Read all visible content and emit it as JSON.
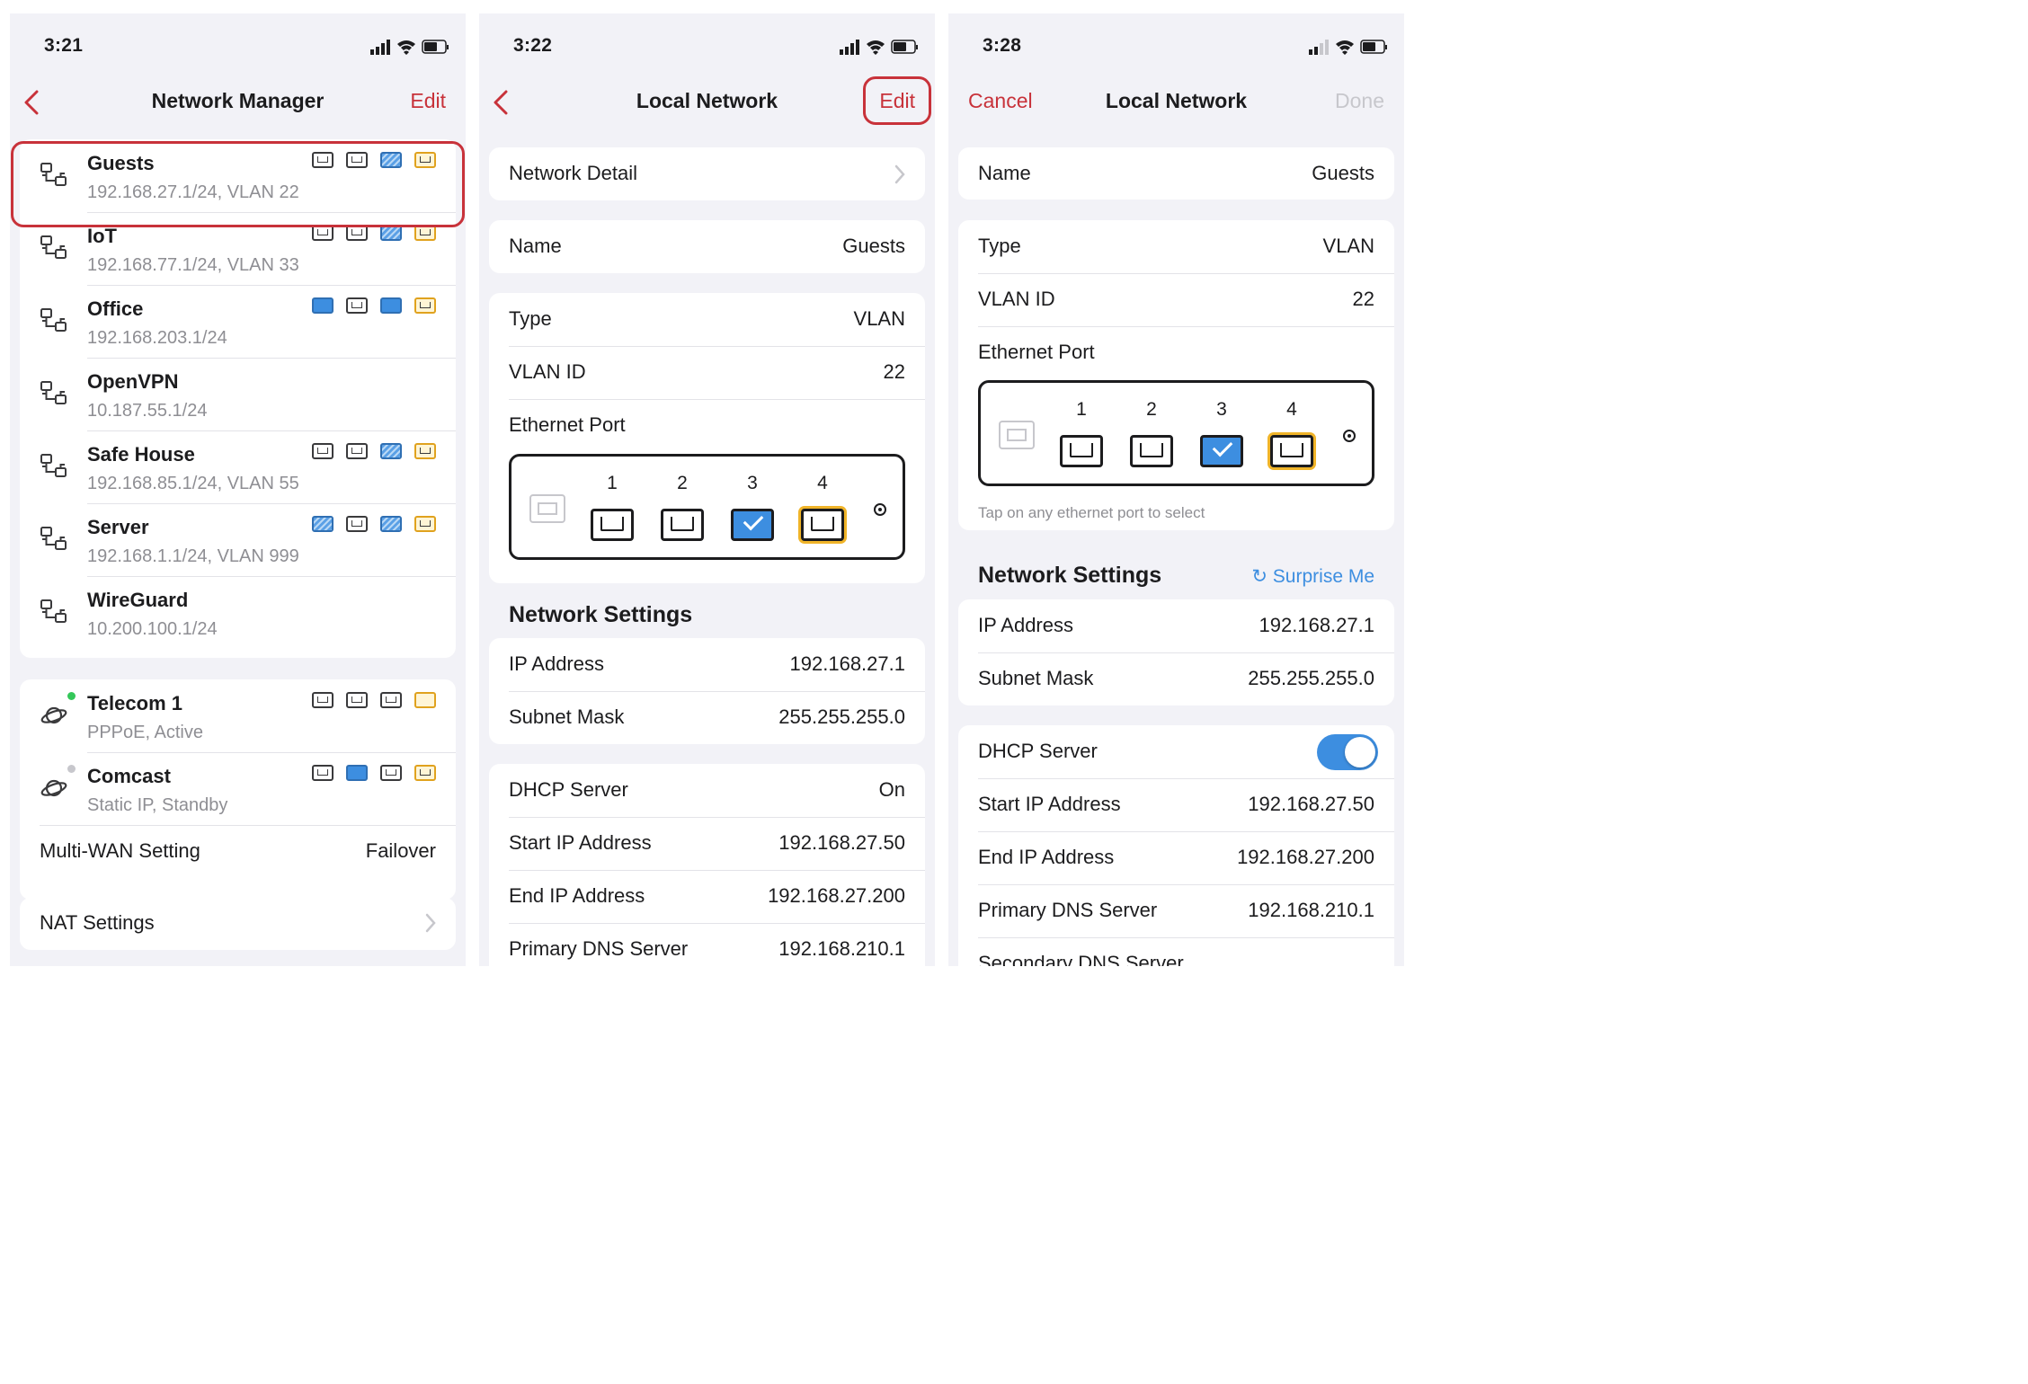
{
  "screens": [
    {
      "status_time": "3:21",
      "nav": {
        "back": "back-chevron",
        "title": "Network Manager",
        "right": "Edit"
      },
      "networks": [
        {
          "name": "Guests",
          "sub": "192.168.27.1/24, VLAN 22",
          "ports": [
            "empty",
            "empty",
            "hatch",
            "gold"
          ]
        },
        {
          "name": "IoT",
          "sub": "192.168.77.1/24, VLAN 33",
          "ports": [
            "empty",
            "empty",
            "hatch",
            "gold"
          ]
        },
        {
          "name": "Office",
          "sub": "192.168.203.1/24",
          "ports": [
            "blue",
            "empty",
            "blue",
            "gold"
          ]
        },
        {
          "name": "OpenVPN",
          "sub": "10.187.55.1/24",
          "ports": []
        },
        {
          "name": "Safe House",
          "sub": "192.168.85.1/24, VLAN 55",
          "ports": [
            "empty",
            "empty",
            "hatch",
            "gold"
          ]
        },
        {
          "name": "Server",
          "sub": "192.168.1.1/24, VLAN 999",
          "ports": [
            "hatch",
            "empty",
            "hatch",
            "gold"
          ]
        },
        {
          "name": "WireGuard",
          "sub": "10.200.100.1/24",
          "ports": []
        }
      ],
      "wans": [
        {
          "name": "Telecom 1",
          "sub": "PPPoE, Active",
          "status_color": "#34c759",
          "ports": [
            "empty",
            "empty",
            "empty",
            "blue-gold"
          ]
        },
        {
          "name": "Comcast",
          "sub": "Static IP, Standby",
          "status_color": "#c7c7cc",
          "ports": [
            "empty",
            "blue",
            "empty",
            "gold"
          ]
        }
      ],
      "multiwan": {
        "label": "Multi-WAN Setting",
        "value": "Failover"
      },
      "nat": {
        "label": "NAT Settings"
      }
    },
    {
      "status_time": "3:22",
      "nav": {
        "title": "Local Network",
        "right": "Edit"
      },
      "detail": "Network Detail",
      "name": {
        "label": "Name",
        "value": "Guests"
      },
      "type": {
        "label": "Type",
        "value": "VLAN"
      },
      "vlan": {
        "label": "VLAN ID",
        "value": "22"
      },
      "eth_label": "Ethernet Port",
      "port_numbers": [
        "1",
        "2",
        "3",
        "4"
      ],
      "section": "Network Settings",
      "ip": {
        "label": "IP Address",
        "value": "192.168.27.1"
      },
      "mask": {
        "label": "Subnet Mask",
        "value": "255.255.255.0"
      },
      "dhcp": {
        "label": "DHCP Server",
        "value": "On"
      },
      "start": {
        "label": "Start IP Address",
        "value": "192.168.27.50"
      },
      "end": {
        "label": "End IP Address",
        "value": "192.168.27.200"
      },
      "dns": {
        "label": "Primary DNS Server",
        "value": "192.168.210.1"
      }
    },
    {
      "status_time": "3:28",
      "nav": {
        "left": "Cancel",
        "title": "Local Network",
        "right": "Done"
      },
      "name": {
        "label": "Name",
        "value": "Guests"
      },
      "type": {
        "label": "Type",
        "value": "VLAN"
      },
      "vlan": {
        "label": "VLAN ID",
        "value": "22"
      },
      "eth_label": "Ethernet Port",
      "port_numbers": [
        "1",
        "2",
        "3",
        "4"
      ],
      "hint": "Tap on any ethernet port to select",
      "section": "Network Settings",
      "surprise": "Surprise Me",
      "ip": {
        "label": "IP Address",
        "value": "192.168.27.1"
      },
      "mask": {
        "label": "Subnet Mask",
        "value": "255.255.255.0"
      },
      "dhcp": {
        "label": "DHCP Server",
        "toggle": "on"
      },
      "start": {
        "label": "Start IP Address",
        "value": "192.168.27.50"
      },
      "end": {
        "label": "End IP Address",
        "value": "192.168.27.200"
      },
      "dns": {
        "label": "Primary DNS Server",
        "value": "192.168.210.1"
      },
      "dns2": {
        "label": "Secondary DNS Server"
      }
    }
  ],
  "colors": {
    "accent": "#c8323a",
    "blue": "#3d8ee0",
    "gold": "#f0b429",
    "active": "#34c759"
  }
}
